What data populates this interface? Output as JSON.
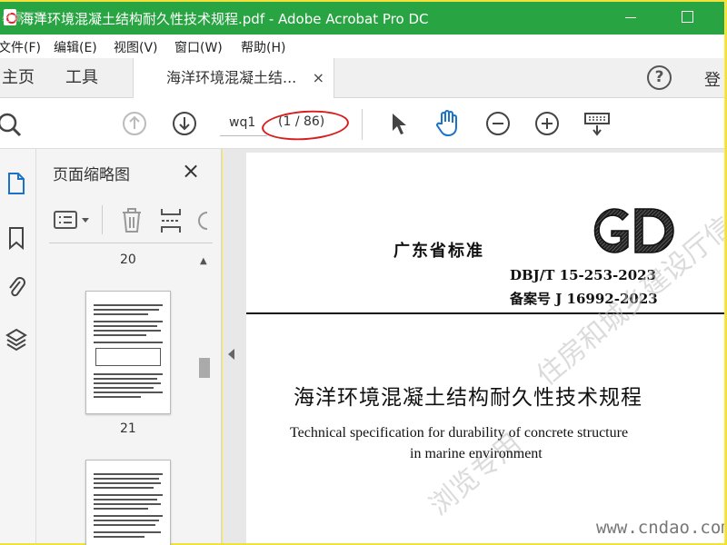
{
  "window": {
    "title": "海洋环境混凝土结构耐久性技术规程.pdf - Adobe Acrobat Pro DC",
    "corner_watermark": "必赢下载"
  },
  "menu": {
    "items": [
      "文件(F)",
      "编辑(E)",
      "视图(V)",
      "窗口(W)",
      "帮助(H)"
    ]
  },
  "tabs": {
    "home": "主页",
    "tools": "工具",
    "document": "海洋环境混凝土结...",
    "close": "×",
    "help": "?",
    "login": "登"
  },
  "toolbar": {
    "page_input": "wq1",
    "page_count": "(1 / 86)"
  },
  "thumbnails": {
    "title": "页面缩略图",
    "close": "×",
    "page_labels": [
      "20",
      "21"
    ]
  },
  "document": {
    "region_standard": "广东省标准",
    "logo_text": "GD",
    "code_line1": "DBJ/T 15-253-2023",
    "code_line2": "备案号 J 16992-2023",
    "title_cn": "海洋环境混凝土结构耐久性技术规程",
    "title_en_line1": "Technical specification for durability of concrete structure",
    "title_en_line2": "in marine environment",
    "watermark1": "住房和城乡建设厅信息公开",
    "watermark2": "浏览专用",
    "site_watermark": "www.cndao.com"
  },
  "colors": {
    "titlebar": "#29a442",
    "frame": "#ffe94a",
    "annotation": "#d91c1c",
    "hand_tool": "#1a73c9"
  }
}
